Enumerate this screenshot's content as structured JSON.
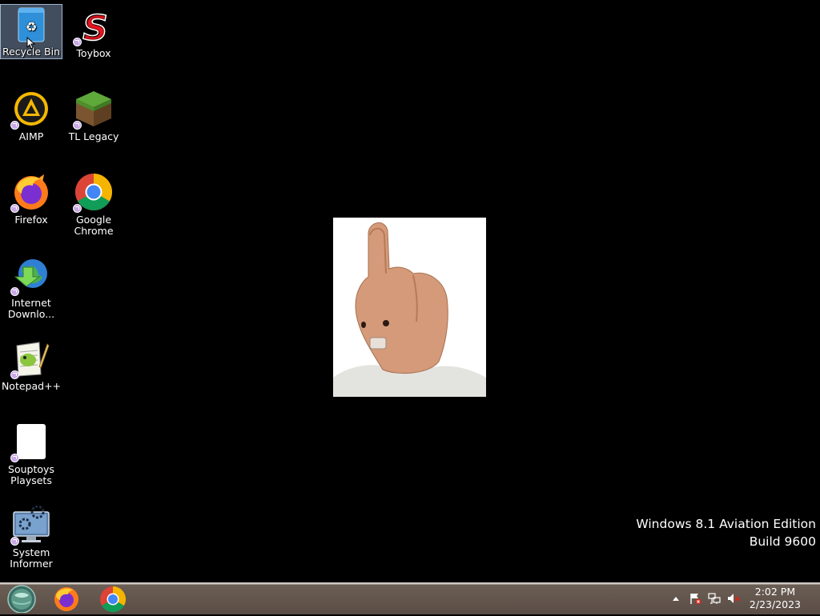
{
  "desktop": {
    "icons": [
      {
        "label": "Recycle Bin"
      },
      {
        "label": "Toybox"
      },
      {
        "label": "AIMP"
      },
      {
        "label": "TL Legacy"
      },
      {
        "label": "Firefox"
      },
      {
        "label": "Google Chrome"
      },
      {
        "label": "Internet Downlo..."
      },
      {
        "label": "Notepad++"
      },
      {
        "label": "Souptoys Playsets"
      },
      {
        "label": "System Informer"
      }
    ]
  },
  "watermark": {
    "line1": "Windows 8.1 Aviation Edition",
    "line2": "Build 9600"
  },
  "taskbar": {
    "start_icon": "start-orb-icon",
    "pinned": [
      "firefox-icon",
      "chrome-icon"
    ],
    "tray": [
      "show-hidden-icons-icon",
      "action-center-flag-icon",
      "network-icon",
      "volume-muted-icon"
    ],
    "time": "2:02 PM",
    "date": "2/23/2023"
  },
  "colors": {
    "desktop_bg": "#000000",
    "taskbar_bg": "#5a4d45",
    "selection": "#7f90aa"
  }
}
